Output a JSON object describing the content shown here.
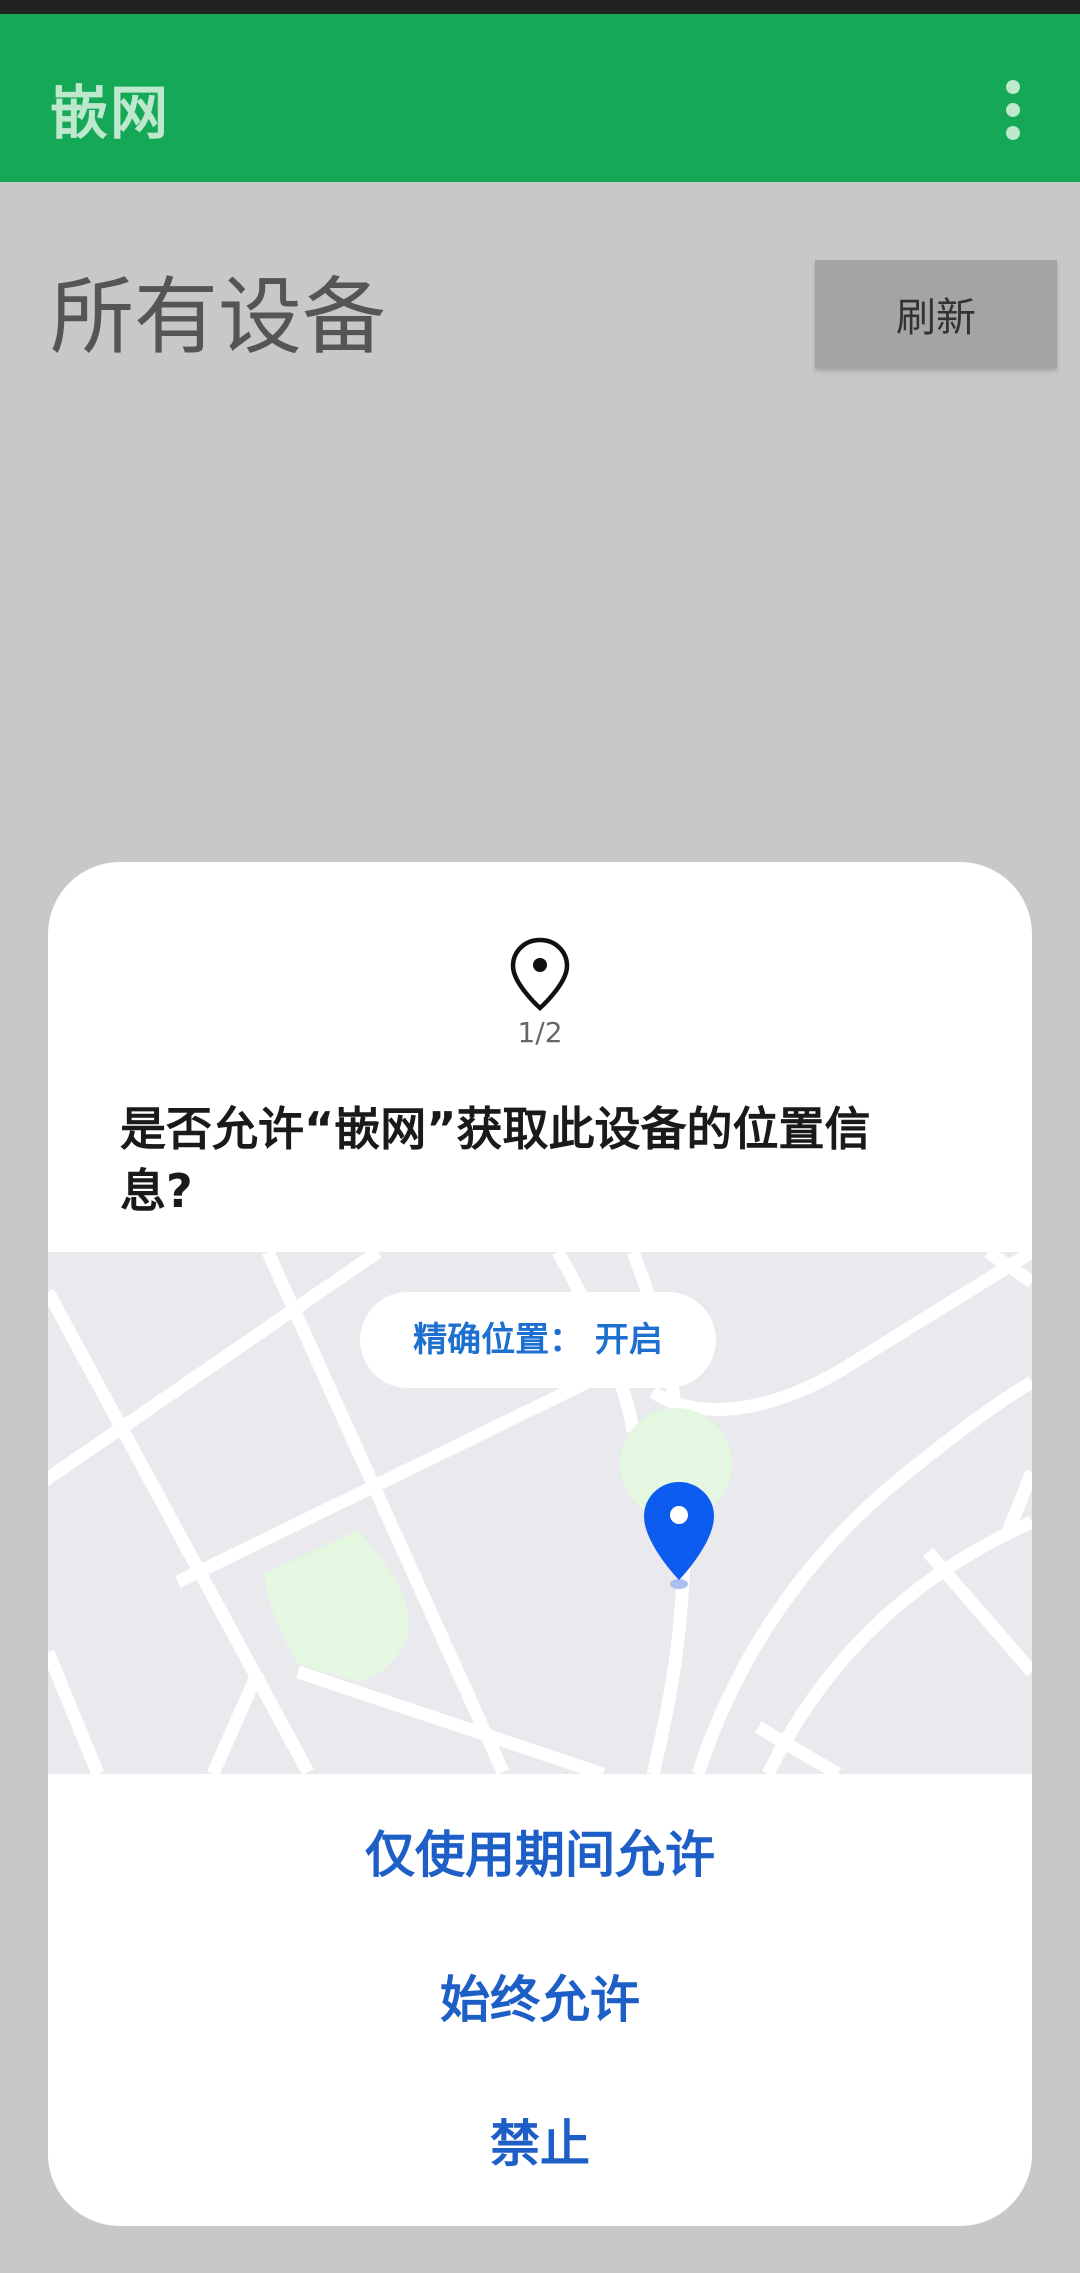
{
  "app": {
    "title": "嵌网"
  },
  "page": {
    "title": "所有设备",
    "refresh_label": "刷新"
  },
  "dialog": {
    "step": "1/2",
    "question": "是否允许“嵌网”获取此设备的位置信息?",
    "precise_location_label": "精确位置： 开启",
    "buttons": {
      "while_using": "仅使用期间允许",
      "always": "始终允许",
      "deny": "禁止"
    }
  },
  "icons": {
    "overflow": "more-vert-icon",
    "location": "location-pin-icon",
    "map_marker": "map-marker-icon"
  },
  "colors": {
    "appbar": "#15a957",
    "accent_blue": "#1d5fc7",
    "marker_blue": "#0d5cf0"
  }
}
